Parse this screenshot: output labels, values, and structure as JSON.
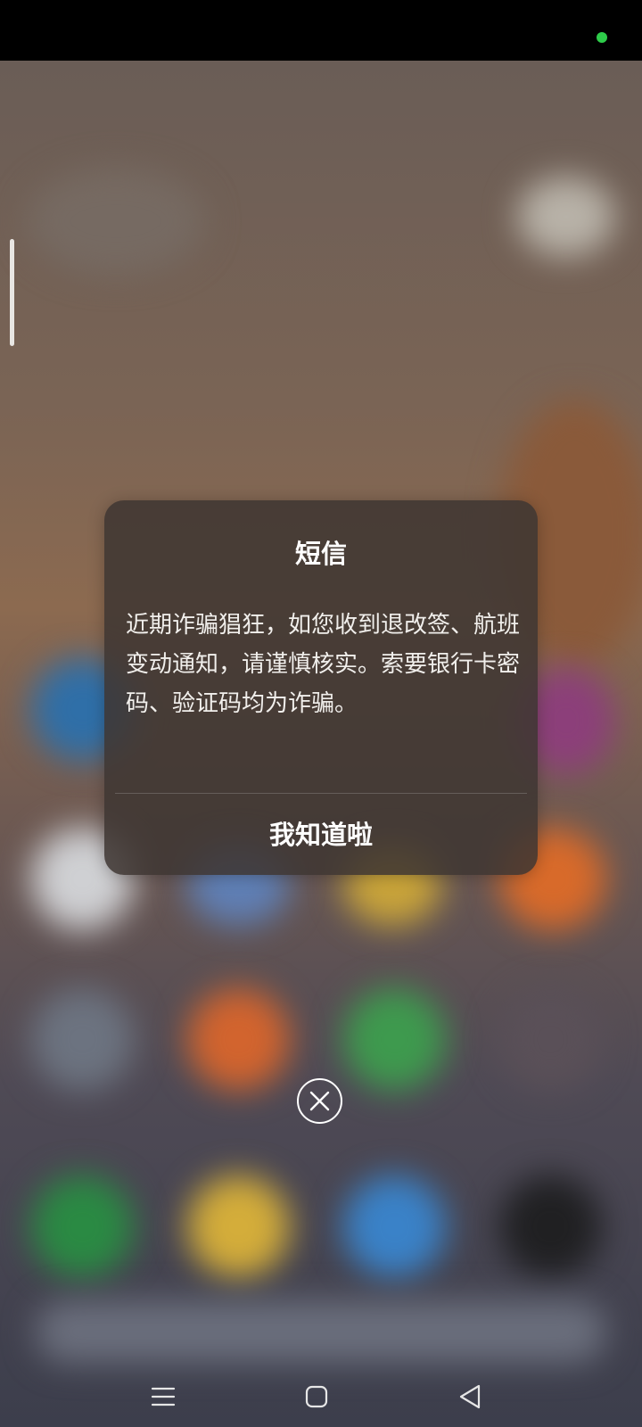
{
  "dialog": {
    "title": "短信",
    "message": "近期诈骗猖狂，如您收到退改签、航班变动通知，请谨慎核实。索要银行卡密码、验证码均为诈骗。",
    "confirm_label": "我知道啦"
  },
  "icons": {
    "status_indicator": "green-dot",
    "close": "close-circle-icon",
    "nav_menu": "menu-icon",
    "nav_home": "home-icon",
    "nav_back": "back-icon"
  },
  "colors": {
    "status_indicator": "#2ecc4a",
    "dialog_background": "#3e3632",
    "text": "#ffffff"
  }
}
